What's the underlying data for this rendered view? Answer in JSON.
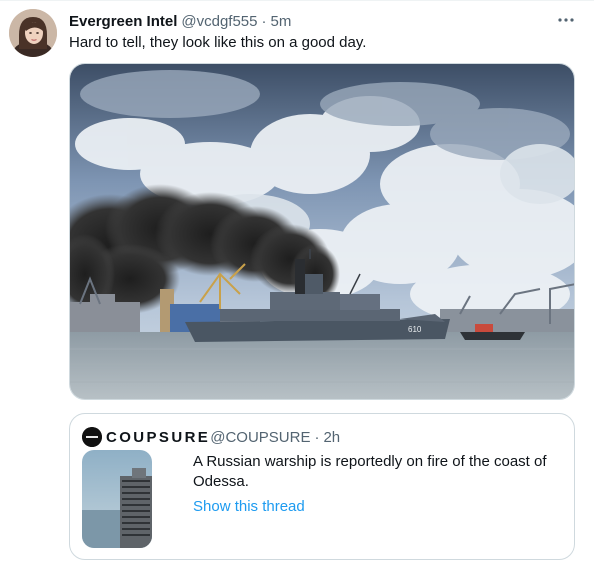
{
  "tweet": {
    "display_name": "Evergreen Intel",
    "handle": "@vcdgf555",
    "separator": "·",
    "time": "5m",
    "text": "Hard to tell, they look like this on a good day.",
    "more_icon": "more-horizontal-icon",
    "media": {
      "ship_number": "610"
    }
  },
  "quote": {
    "display_name": "COUPSURE",
    "handle": "@COUPSURE",
    "separator": "·",
    "time": "2h",
    "text": "A Russian warship is reportedly on fire of the coast of Odessa.",
    "show_thread": "Show this thread"
  },
  "colors": {
    "text_primary": "#0f1419",
    "text_secondary": "#536471",
    "link": "#1d9bf0",
    "border": "#cfd9de"
  }
}
